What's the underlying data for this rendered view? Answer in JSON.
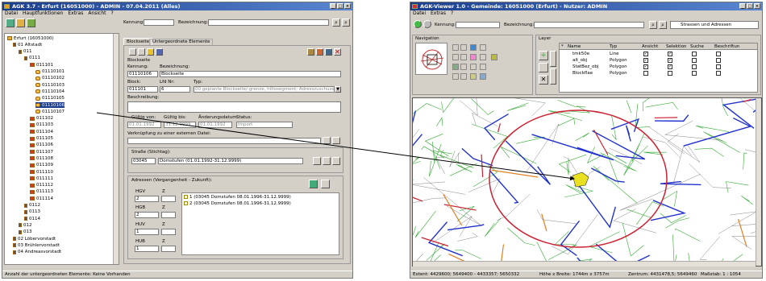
{
  "left": {
    "title": "AGK 3.7 - Erfurt (16051000) - ADMIN - 07.04.2011 (Alles)",
    "menu": [
      "Datei",
      "Hauptfunktionen",
      "Extras",
      "Ansicht",
      "?"
    ],
    "kennung_label": "Kennung:",
    "bezeichnung_label": "Bezeichnung:",
    "tabs": [
      "Blockseite",
      "Untergeordnete Elemente"
    ],
    "tree": [
      {
        "label": "Erfurt (16051000)",
        "indent": 0,
        "type": "root"
      },
      {
        "label": "01 Altstadt",
        "indent": 1,
        "type": "node"
      },
      {
        "label": "011",
        "indent": 2,
        "type": "node"
      },
      {
        "label": "0111",
        "indent": 3,
        "type": "node"
      },
      {
        "label": "011101",
        "indent": 4,
        "type": "red"
      },
      {
        "label": "01110101",
        "indent": 5,
        "type": "key"
      },
      {
        "label": "01110102",
        "indent": 5,
        "type": "key"
      },
      {
        "label": "01110103",
        "indent": 5,
        "type": "key"
      },
      {
        "label": "01110104",
        "indent": 5,
        "type": "key"
      },
      {
        "label": "01110105",
        "indent": 5,
        "type": "key"
      },
      {
        "label": "01110106",
        "indent": 5,
        "type": "key",
        "selected": true
      },
      {
        "label": "01110107",
        "indent": 5,
        "type": "key"
      },
      {
        "label": "011102",
        "indent": 4,
        "type": "red"
      },
      {
        "label": "011103",
        "indent": 4,
        "type": "red"
      },
      {
        "label": "011104",
        "indent": 4,
        "type": "red"
      },
      {
        "label": "011105",
        "indent": 4,
        "type": "red"
      },
      {
        "label": "011106",
        "indent": 4,
        "type": "red"
      },
      {
        "label": "011107",
        "indent": 4,
        "type": "red"
      },
      {
        "label": "011108",
        "indent": 4,
        "type": "red"
      },
      {
        "label": "011109",
        "indent": 4,
        "type": "red"
      },
      {
        "label": "011110",
        "indent": 4,
        "type": "red"
      },
      {
        "label": "011111",
        "indent": 4,
        "type": "red"
      },
      {
        "label": "011112",
        "indent": 4,
        "type": "red"
      },
      {
        "label": "011113",
        "indent": 4,
        "type": "red"
      },
      {
        "label": "011114",
        "indent": 4,
        "type": "red"
      },
      {
        "label": "0112",
        "indent": 3,
        "type": "node"
      },
      {
        "label": "0113",
        "indent": 3,
        "type": "node"
      },
      {
        "label": "0114",
        "indent": 3,
        "type": "node"
      },
      {
        "label": "012",
        "indent": 2,
        "type": "node"
      },
      {
        "label": "013",
        "indent": 2,
        "type": "node"
      },
      {
        "label": "02 Löbervorstadt",
        "indent": 1,
        "type": "node"
      },
      {
        "label": "03 Brühlervorstadt",
        "indent": 1,
        "type": "node"
      },
      {
        "label": "04 Andreasvorstadt",
        "indent": 1,
        "type": "node"
      }
    ],
    "form": {
      "section": "Blockseite",
      "kennung_label": "Kennung:",
      "bezeichnung_label": "Bezeichnung:",
      "kennung": "01110106",
      "bezeichnung": "Blockseite",
      "block_label": "Block:",
      "lfdnr_label": "Lfd Nr:",
      "typ_label": "Typ:",
      "block": "011101",
      "lfdnr": "6",
      "typ": "00 geplante Blockseite/-grenze, hiltosegment; Adresszuschuss",
      "beschreibung_label": "Beschreibung:",
      "gueltig_von_label": "Gültig von:",
      "gueltig_bis_label": "Gültig bis:",
      "aenderung_label": "Änderungsdatum:",
      "status_label": "Status:",
      "gueltig_von": "01.01.1992",
      "gueltig_bis": "31.12.9999",
      "aenderung": "01.01.1992",
      "status": "Import",
      "verknuepfung_label": "Verknüpfung zu einer externen Datei:",
      "strasse_label": "Straße (Stichtag):",
      "strasse_nr": "03045",
      "strasse_name": "Domstufen (01.01.1992-31.12.9999)",
      "adressen_label": "Adressen (Vergangenheit - Zukunft):",
      "hgv_label": "HGV",
      "hgv_z_label": "Z",
      "hgv": "2",
      "hgb_label": "HGB",
      "hgb_z_label": "Z",
      "hgb": "2",
      "huv_label": "HUV",
      "huv_z_label": "Z",
      "huv": "1",
      "hub_label": "HUB",
      "hub_z_label": "Z",
      "hub": "1",
      "addresses": [
        "1 (03045 Domstufen 08.01.1996-31.12.9999)",
        "2 (03045 Domstufen 08.01.1996-31.12.9999)"
      ]
    },
    "status": "Anzahl der untergeordneten Elemente: Keine Vorhanden"
  },
  "right": {
    "title": "AGK-Viewer 1.0 - Gemeinde: 16051000 (Erfurt) - Nutzer: ADMIN",
    "menu": [
      "Datei",
      "Extras",
      "?"
    ],
    "kennung_label": "Kennung:",
    "bezeichnung_label": "Bezeichnung:",
    "strassen": "Strassen und Adressen",
    "navigation_label": "Navigation",
    "layer_label": "Layer",
    "layer_headers": [
      "*",
      "Name",
      "Typ",
      "Ansicht",
      "Selektion",
      "Suche",
      "Beschriftun"
    ],
    "layers": [
      {
        "name": "tmk50e",
        "typ": "Line"
      },
      {
        "name": "alt_obj",
        "typ": "Polygon"
      },
      {
        "name": "StatBez_obj",
        "typ": "Polygon"
      },
      {
        "name": "Blockflae",
        "typ": "Polygon"
      }
    ],
    "status": {
      "extent": "Extent: 4429600; 5649400 - 4433357; 5650332",
      "size": "Höhe x Breite: 1744m x 3757m",
      "center": "Zentrum: 4431478,5; 5649460",
      "scale": "Maßstab: 1 : 1054"
    }
  },
  "colors": {
    "title_bar": "#1a3e8c",
    "street_blue": "#2233cc",
    "street_red": "#cc2233",
    "street_orange": "#e08020",
    "green": "#33aa33",
    "highlight": "#e8e020"
  }
}
